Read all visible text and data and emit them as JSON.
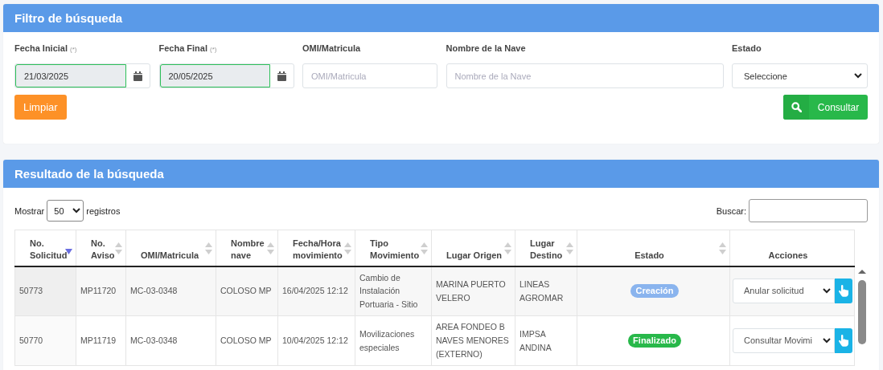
{
  "filter_panel": {
    "title": "Filtro de búsqueda",
    "fields": [
      {
        "kind": "date",
        "label": "Fecha Inicial",
        "required_mark": "(*)",
        "value": "21/03/2025",
        "valid": true
      },
      {
        "kind": "date",
        "label": "Fecha Final",
        "required_mark": "(*)",
        "value": "20/05/2025",
        "valid": true
      },
      {
        "kind": "text",
        "label": "OMI/Matricula",
        "placeholder": "OMI/Matricula"
      },
      {
        "kind": "text",
        "label": "Nombre de la Nave",
        "placeholder": "Nombre de la Nave"
      },
      {
        "kind": "select",
        "label": "Estado",
        "value": "Seleccione"
      }
    ],
    "clear_button": "Limpiar",
    "search_button": "Consultar"
  },
  "results_panel": {
    "title": "Resultado de la búsqueda",
    "show_label": "Mostrar",
    "page_size": "50",
    "records_label": "registros",
    "search_label": "Buscar:",
    "table": {
      "columns": [
        {
          "label": "No. Solicitud",
          "sortable": true,
          "sorted_descending": true
        },
        {
          "label": "No. Aviso",
          "sortable": true,
          "sorted_descending": false
        },
        {
          "label": "OMI/Matricula",
          "sortable": true,
          "sorted_descending": false
        },
        {
          "label": "Nombre nave",
          "sortable": true,
          "sorted_descending": false
        },
        {
          "label": "Fecha/Hora movimiento",
          "sortable": true,
          "sorted_descending": false
        },
        {
          "label": "Tipo Movimiento",
          "sortable": true,
          "sorted_descending": false
        },
        {
          "label": "Lugar Origen",
          "sortable": true,
          "sorted_descending": false
        },
        {
          "label": "Lugar Destino",
          "sortable": true,
          "sorted_descending": false
        },
        {
          "label": "Estado",
          "sortable": true,
          "sorted_descending": false
        },
        {
          "label": "Acciones",
          "sortable": false
        }
      ],
      "rows": [
        {
          "cells": [
            "50773",
            "MP11720",
            "MC-03-0348",
            "COLOSO MP",
            "16/04/2025 12:12",
            "Cambio de Instalación Portuaria - Sitio",
            "MARINA PUERTO VELERO",
            "LINEAS AGROMAR"
          ],
          "status": {
            "label": "Creación",
            "color": "#8ab4ee"
          },
          "action": "Anular solicitud"
        },
        {
          "cells": [
            "50770",
            "MP11719",
            "MC-03-0348",
            "COLOSO MP",
            "10/04/2025 12:12",
            "Movilizaciones especiales",
            "AREA FONDEO B NAVES MENORES (EXTERNO)",
            "IMPSA ANDINA"
          ],
          "status": {
            "label": "Finalizado",
            "color": "#28b84a"
          },
          "action": "Consultar Movimi"
        }
      ]
    }
  }
}
